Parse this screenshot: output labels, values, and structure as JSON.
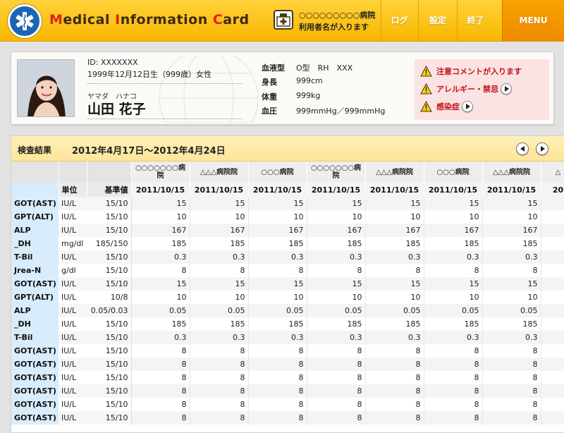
{
  "header": {
    "brand_parts": [
      {
        "cap": "M",
        "rest": "edical "
      },
      {
        "cap": "I",
        "rest": "nformation "
      },
      {
        "cap": "C",
        "rest": "ard"
      }
    ],
    "hospital_name": "○○○○○○○○○病院",
    "user_name": "利用者名が入ります",
    "nav": {
      "log": "ログ",
      "settings": "設定",
      "exit": "終了",
      "menu": "MENU"
    }
  },
  "profile": {
    "id": "ID: XXXXXXX",
    "dob": "1999年12月12日生（999歳）女性",
    "kana": "ヤマダ　ハナコ",
    "name": "山田 花子",
    "vitals": [
      {
        "label": "血液型",
        "value": "O型　RH　XXX"
      },
      {
        "label": "身長",
        "value": "999cm"
      },
      {
        "label": "体重",
        "value": "999kg"
      },
      {
        "label": "血圧",
        "value": "999mmHg／999mmHg"
      }
    ],
    "alerts": [
      {
        "text": "注意コメントが入ります",
        "has_link": false
      },
      {
        "text": "アレルギー・禁忌",
        "has_link": true
      },
      {
        "text": "感染症",
        "has_link": true
      }
    ]
  },
  "results": {
    "title": "検査結果",
    "range": "2012年4月17日〜2012年4月24日",
    "unit_header": "単位",
    "ref_header": "基準値",
    "hospitals": [
      "○○○○○○○病院",
      "△△△病院院",
      "○○○病院",
      "○○○○○○○病院",
      "△△△病院院",
      "○○○病院",
      "△△△病院院",
      "△"
    ],
    "dates": [
      "2011/10/15",
      "2011/10/15",
      "2011/10/15",
      "2011/10/15",
      "2011/10/15",
      "2011/10/15",
      "2011/10/15",
      "20"
    ],
    "rows": [
      {
        "item": "GOT(AST)",
        "unit": "IU/L",
        "ref": "15/10",
        "values": [
          "15",
          "15",
          "15",
          "15",
          "15",
          "15",
          "15"
        ]
      },
      {
        "item": "GPT(ALT)",
        "unit": "IU/L",
        "ref": "15/10",
        "values": [
          "10",
          "10",
          "10",
          "10",
          "10",
          "10",
          "10"
        ]
      },
      {
        "item": "ALP",
        "unit": "IU/L",
        "ref": "15/10",
        "values": [
          "167",
          "167",
          "167",
          "167",
          "167",
          "167",
          "167"
        ]
      },
      {
        "item": "_DH",
        "unit": "mg/dl",
        "ref": "185/150",
        "values": [
          "185",
          "185",
          "185",
          "185",
          "185",
          "185",
          "185"
        ]
      },
      {
        "item": "T-Bil",
        "unit": "IU/L",
        "ref": "15/10",
        "values": [
          "0.3",
          "0.3",
          "0.3",
          "0.3",
          "0.3",
          "0.3",
          "0.3"
        ]
      },
      {
        "item": "Jrea-N",
        "unit": "g/dl",
        "ref": "15/10",
        "values": [
          "8",
          "8",
          "8",
          "8",
          "8",
          "8",
          "8"
        ]
      },
      {
        "item": "GOT(AST)",
        "unit": "IU/L",
        "ref": "15/10",
        "values": [
          "15",
          "15",
          "15",
          "15",
          "15",
          "15",
          "15"
        ]
      },
      {
        "item": "GPT(ALT)",
        "unit": "IU/L",
        "ref": "10/8",
        "values": [
          "10",
          "10",
          "10",
          "10",
          "10",
          "10",
          "10"
        ]
      },
      {
        "item": "ALP",
        "unit": "IU/L",
        "ref": "0.05/0.03",
        "values": [
          "0.05",
          "0.05",
          "0.05",
          "0.05",
          "0.05",
          "0.05",
          "0.05"
        ]
      },
      {
        "item": "_DH",
        "unit": "IU/L",
        "ref": "15/10",
        "values": [
          "185",
          "185",
          "185",
          "185",
          "185",
          "185",
          "185"
        ]
      },
      {
        "item": "T-Bil",
        "unit": "IU/L",
        "ref": "15/10",
        "values": [
          "0.3",
          "0.3",
          "0.3",
          "0.3",
          "0.3",
          "0.3",
          "0.3"
        ]
      },
      {
        "item": "GOT(AST)",
        "unit": "IU/L",
        "ref": "15/10",
        "values": [
          "8",
          "8",
          "8",
          "8",
          "8",
          "8",
          "8"
        ]
      },
      {
        "item": "GOT(AST)",
        "unit": "IU/L",
        "ref": "15/10",
        "values": [
          "8",
          "8",
          "8",
          "8",
          "8",
          "8",
          "8"
        ]
      },
      {
        "item": "GOT(AST)",
        "unit": "IU/L",
        "ref": "15/10",
        "values": [
          "8",
          "8",
          "8",
          "8",
          "8",
          "8",
          "8"
        ]
      },
      {
        "item": "GOT(AST)",
        "unit": "IU/L",
        "ref": "15/10",
        "values": [
          "8",
          "8",
          "8",
          "8",
          "8",
          "8",
          "8"
        ]
      },
      {
        "item": "GOT(AST)",
        "unit": "IU/L",
        "ref": "15/10",
        "values": [
          "8",
          "8",
          "8",
          "8",
          "8",
          "8",
          "8"
        ]
      },
      {
        "item": "GOT(AST)",
        "unit": "IU/L",
        "ref": "15/10",
        "values": [
          "8",
          "8",
          "8",
          "8",
          "8",
          "8",
          "8"
        ]
      }
    ]
  }
}
